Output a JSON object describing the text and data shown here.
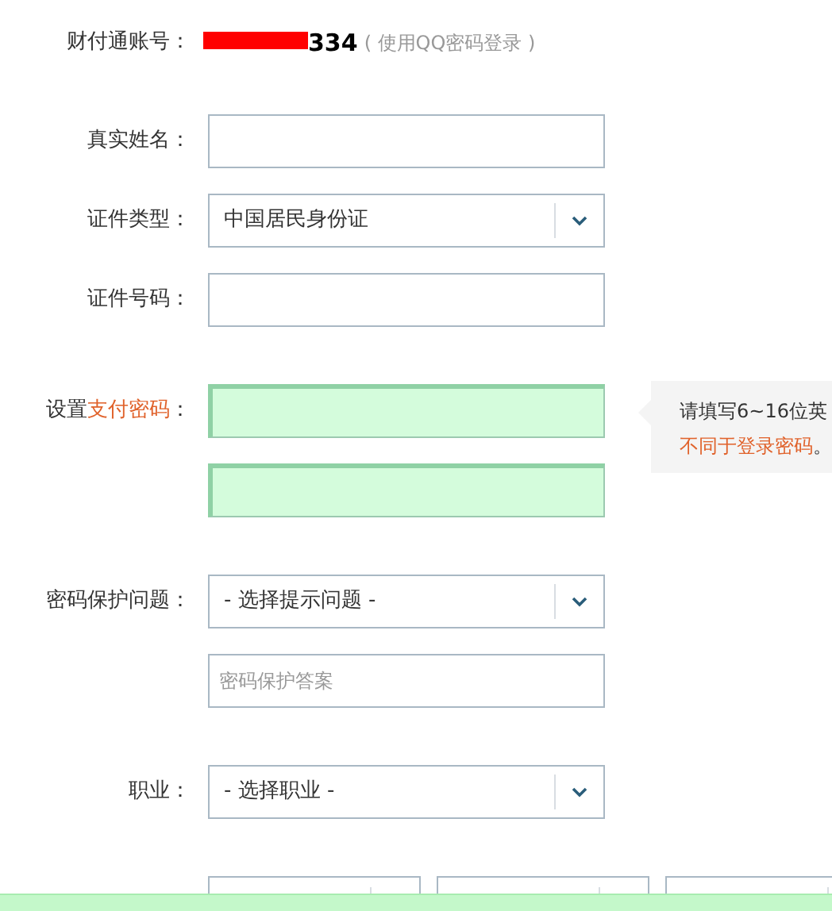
{
  "account": {
    "label": "财付通账号：",
    "number": "334",
    "redacted": true,
    "hint": "( 使用QQ密码登录 )"
  },
  "sections": [
    {
      "rows": [
        {
          "kind": "input",
          "label": [
            {
              "text": "真实姓名："
            }
          ]
        },
        {
          "kind": "select",
          "label": [
            {
              "text": "证件类型："
            }
          ],
          "value": "中国居民身份证"
        },
        {
          "kind": "input",
          "label": [
            {
              "text": "证件号码："
            }
          ]
        }
      ]
    },
    {
      "rows": [
        {
          "kind": "password",
          "label": [
            {
              "text": "设置"
            },
            {
              "text": "支付密码",
              "accent": true
            },
            {
              "text": "："
            }
          ],
          "focused": true
        },
        {
          "kind": "password",
          "label": [],
          "focused": true
        }
      ]
    },
    {
      "rows": [
        {
          "kind": "select",
          "label": [
            {
              "text": "密码保护问题："
            }
          ],
          "value": "- 选择提示问题 -"
        },
        {
          "kind": "input",
          "label": [],
          "placeholder": "密码保护答案"
        }
      ]
    },
    {
      "rows": [
        {
          "kind": "select",
          "label": [
            {
              "text": "职业："
            }
          ],
          "value": "- 选择职业 -"
        }
      ]
    },
    {
      "rows": [
        {
          "kind": "triple-select",
          "label": []
        }
      ]
    }
  ],
  "tooltip": {
    "line1": "请填写6~16位英",
    "line2_accent": "不同于登录密码",
    "line2_end": "。"
  }
}
